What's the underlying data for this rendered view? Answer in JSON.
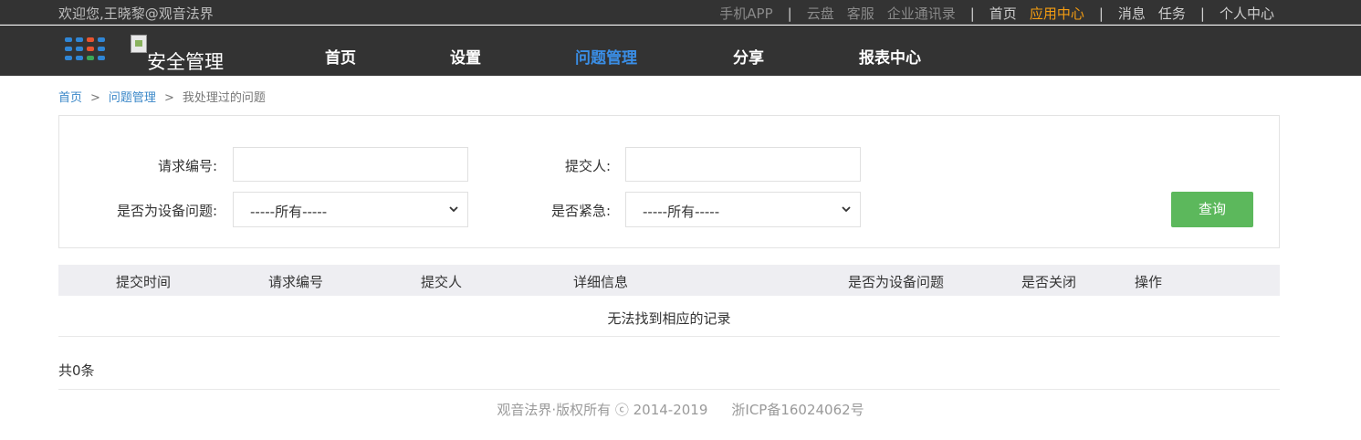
{
  "topbar": {
    "welcome": "欢迎您,王晓黎@观音法界",
    "links": [
      {
        "label": "手机APP",
        "style": "dim"
      },
      {
        "sep": "|"
      },
      {
        "label": "云盘",
        "style": "dim"
      },
      {
        "label": "客服",
        "style": "dim"
      },
      {
        "label": "企业通讯录",
        "style": "dim"
      },
      {
        "sep": "|"
      },
      {
        "label": "首页",
        "style": "lite"
      },
      {
        "label": "应用中心",
        "style": "active"
      },
      {
        "sep": "|"
      },
      {
        "label": "消息",
        "style": "lite"
      },
      {
        "label": "任务",
        "style": "lite"
      },
      {
        "sep": "|"
      },
      {
        "label": "个人中心",
        "style": "lite"
      }
    ]
  },
  "nav": {
    "logo_text": "安全管理",
    "apps_icon": "apps-grid-icon",
    "apps_colors": [
      "#2f86d6",
      "#2f86d6",
      "#e8542f",
      "#2f86d6",
      "#2f86d6",
      "#2f86d6",
      "#e8542f",
      "#2f86d6",
      "#2f86d6",
      "#2f86d6",
      "#3aa757",
      "#2f86d6"
    ],
    "items": [
      {
        "label": "首页",
        "active": false
      },
      {
        "label": "设置",
        "active": false
      },
      {
        "label": "问题管理",
        "active": true
      },
      {
        "label": "分享",
        "active": false
      },
      {
        "label": "报表中心",
        "active": false
      }
    ],
    "active_color": "#3a8ee6"
  },
  "breadcrumb": {
    "home": "首页",
    "section": "问题管理",
    "current": "我处理过的问题",
    "separator": ">"
  },
  "filter": {
    "request_no_label": "请求编号:",
    "request_no_value": "",
    "submitter_label": "提交人:",
    "submitter_value": "",
    "device_issue_label": "是否为设备问题:",
    "device_issue_value": "-----所有-----",
    "urgent_label": "是否紧急:",
    "urgent_value": "-----所有-----",
    "search_button": "查询",
    "search_button_color": "#5cb85c"
  },
  "table": {
    "columns": [
      "提交时间",
      "请求编号",
      "提交人",
      "详细信息",
      "是否为设备问题",
      "是否关闭",
      "操作"
    ],
    "rows": [],
    "empty_message": "无法找到相应的记录"
  },
  "pagination": {
    "total": "共0条"
  },
  "footer": {
    "copyright": "观音法界·版权所有 ⓒ 2014-2019",
    "icp": "浙ICP备16024062号"
  }
}
